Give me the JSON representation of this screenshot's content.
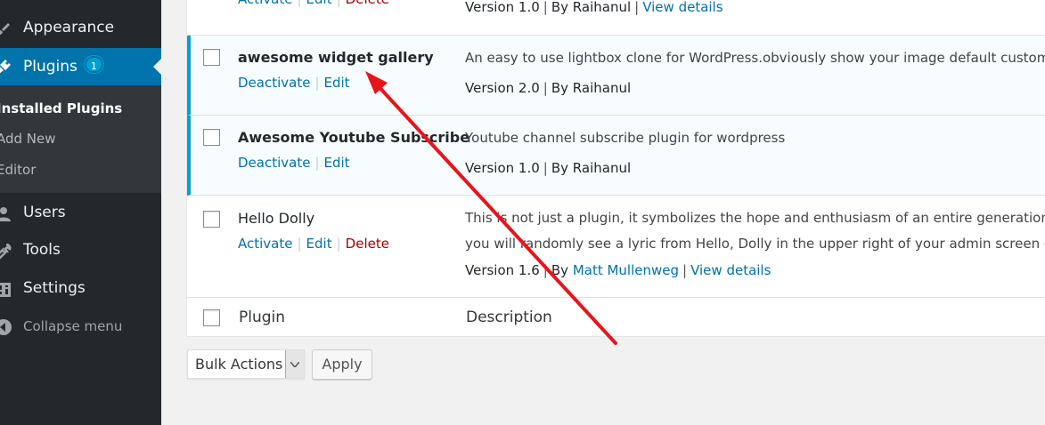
{
  "sidebar": {
    "items": [
      {
        "label": "Appearance",
        "icon": "paintbrush-icon"
      },
      {
        "label": "Plugins",
        "icon": "plugin-icon",
        "badge": "1"
      },
      {
        "label": "Users",
        "icon": "users-icon"
      },
      {
        "label": "Tools",
        "icon": "wrench-icon"
      },
      {
        "label": "Settings",
        "icon": "settings-icon"
      }
    ],
    "submenu": [
      "Installed Plugins",
      "Add New",
      "Editor"
    ],
    "collapse_label": "Collapse menu"
  },
  "plugins": [
    {
      "actions": [
        "Activate",
        "Edit",
        "Delete"
      ],
      "version": "Version 1.0",
      "by": "By Raihanul",
      "view_details": "View details"
    },
    {
      "name": "awesome widget gallery",
      "actions": [
        "Deactivate",
        "Edit"
      ],
      "description": "An easy to use lightbox clone for WordPress.obviously show your image default custom post",
      "version": "Version 2.0",
      "by": "By Raihanul"
    },
    {
      "name": "Awesome Youtube Subscribe",
      "actions": [
        "Deactivate",
        "Edit"
      ],
      "description": "Youtube channel subscribe plugin for wordpress",
      "version": "Version 1.0",
      "by": "By Raihanul"
    },
    {
      "name": "Hello Dolly",
      "actions": [
        "Activate",
        "Edit",
        "Delete"
      ],
      "description_line1": "This is not just a plugin, it symbolizes the hope and enthusiasm of an entire generation summ",
      "description_line2": "you will randomly see a lyric from Hello, Dolly in the upper right of your admin screen on eve",
      "version": "Version 1.6",
      "by_prefix": "By",
      "author": "Matt Mullenweg",
      "view_details": "View details"
    }
  ],
  "table_footer": {
    "plugin": "Plugin",
    "description": "Description"
  },
  "bulk": {
    "selected": "Bulk Actions",
    "apply": "Apply"
  },
  "colors": {
    "sidebar": "#23282d",
    "accent": "#0073aa",
    "active_border": "#00a0d2",
    "delete": "#aa0000",
    "annotation": "#e8141b"
  }
}
